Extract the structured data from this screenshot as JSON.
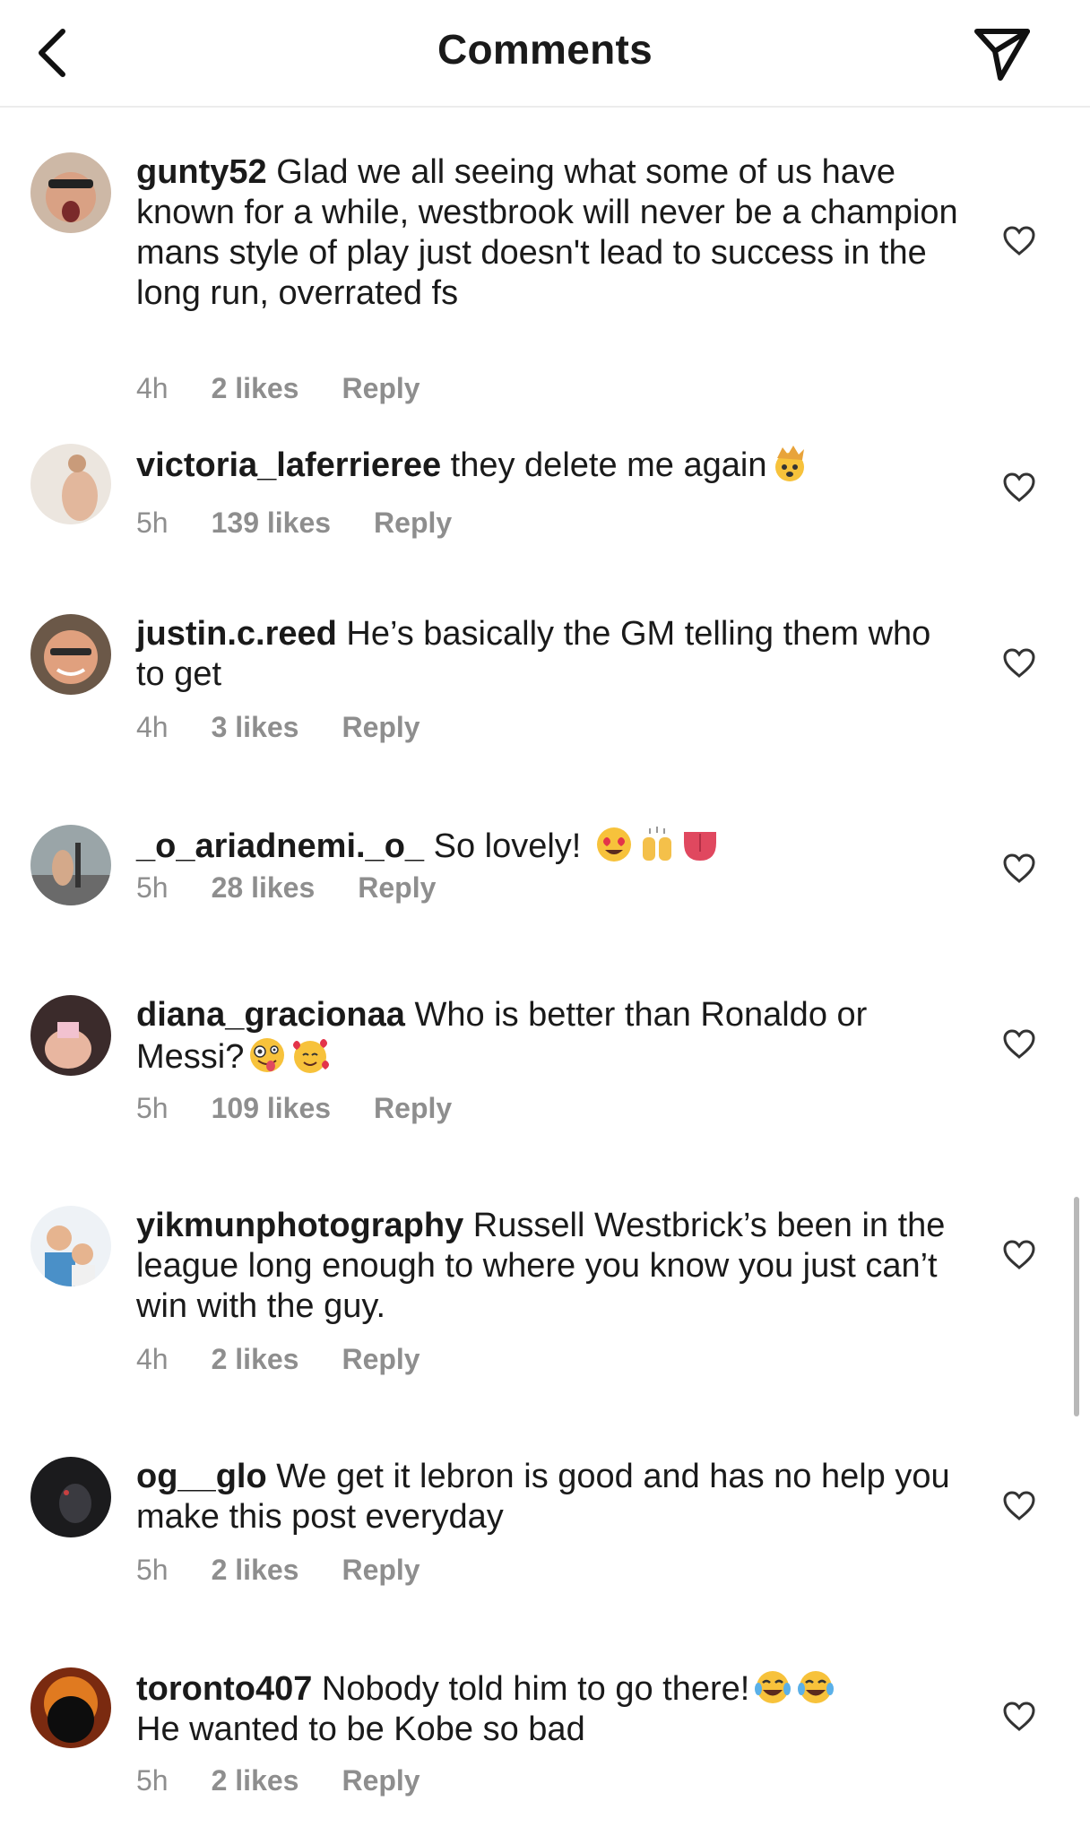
{
  "header": {
    "title": "Comments",
    "back_icon": "chevron-left-icon",
    "share_icon": "paper-plane-icon"
  },
  "comments": [
    {
      "username": "gunty52",
      "text": " Glad we all seeing what some of us have known for a while, westbrook will never be a champion mans style of play just doesn't lead to success in the long run, overrated fs",
      "time": "4h",
      "likes": "2 likes",
      "reply": "Reply",
      "liked": false
    },
    {
      "username": "victoria_laferrieree",
      "text": " they delete me again",
      "emojis": [
        "exploding-head-emoji"
      ],
      "time": "5h",
      "likes": "139 likes",
      "reply": "Reply",
      "liked": false
    },
    {
      "username": "justin.c.reed",
      "text": " He’s basically the GM telling them who to get",
      "time": "4h",
      "likes": "3 likes",
      "reply": "Reply",
      "liked": false
    },
    {
      "username": "_o_ariadnemi._o_",
      "text": " So lovely! ",
      "emojis": [
        "heart-eyes-emoji",
        "raising-hands-emoji",
        "tongue-emoji"
      ],
      "time": "5h",
      "likes": "28 likes",
      "reply": "Reply",
      "liked": false
    },
    {
      "username": "diana_gracionaa",
      "text": " Who is better than Ronaldo or Messi?",
      "emojis": [
        "zany-face-emoji",
        "smiling-hearts-emoji"
      ],
      "time": "5h",
      "likes": "109 likes",
      "reply": "Reply",
      "liked": false
    },
    {
      "username": "yikmunphotography",
      "text": " Russell Westbrick’s been in the league long enough to where you know you just can’t win with the guy.",
      "time": "4h",
      "likes": "2 likes",
      "reply": "Reply",
      "liked": false
    },
    {
      "username": "og__glo",
      "text": " We get it lebron is good and has no help you make this post everyday",
      "time": "5h",
      "likes": "2 likes",
      "reply": "Reply",
      "liked": false
    },
    {
      "username": "toronto407",
      "text": " Nobody told him to go there!",
      "text2": "He wanted to be Kobe so bad",
      "emojis": [
        "tears-of-joy-emoji",
        "tears-of-joy-emoji"
      ],
      "time": "5h",
      "likes": "2 likes",
      "reply": "Reply",
      "liked": false
    }
  ],
  "colors": {
    "text": "#1a1a1a",
    "meta": "#8e8e8e",
    "divider": "#ececec"
  }
}
